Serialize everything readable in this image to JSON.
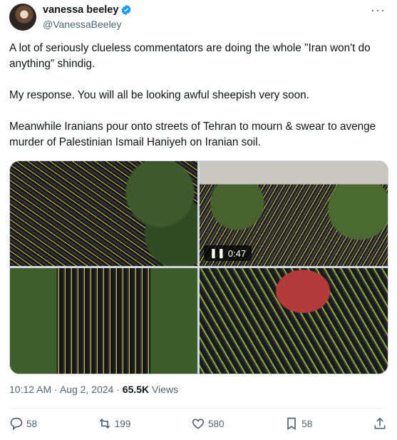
{
  "tweet": {
    "author_name": "vanessa beeley",
    "author_handle": "@VanessaBeeley",
    "text": "A lot of seriously clueless commentators are doing the whole \"Iran won't do anything\" shindig.\n\nMy response. You will all be looking awful sheepish very soon.\n\nMeanwhile Iranians pour onto streets of Tehran to mourn & swear to avenge murder of Palestinian Ismail Haniyeh on Iranian soil.",
    "video_duration": "0:47",
    "time": "10:12 AM",
    "date": "Aug 2, 2024",
    "views_count": "65.5K",
    "views_label": "Views"
  },
  "actions": {
    "replies": "58",
    "reposts": "199",
    "likes": "580",
    "bookmarks": "58"
  },
  "colors": {
    "verified": "#1d9bf0",
    "muted": "#536471",
    "text": "#0f1419"
  },
  "icons": [
    "verified-badge-icon",
    "more-icon",
    "reply-icon",
    "repost-icon",
    "like-icon",
    "bookmark-icon",
    "share-icon",
    "pause-icon"
  ]
}
